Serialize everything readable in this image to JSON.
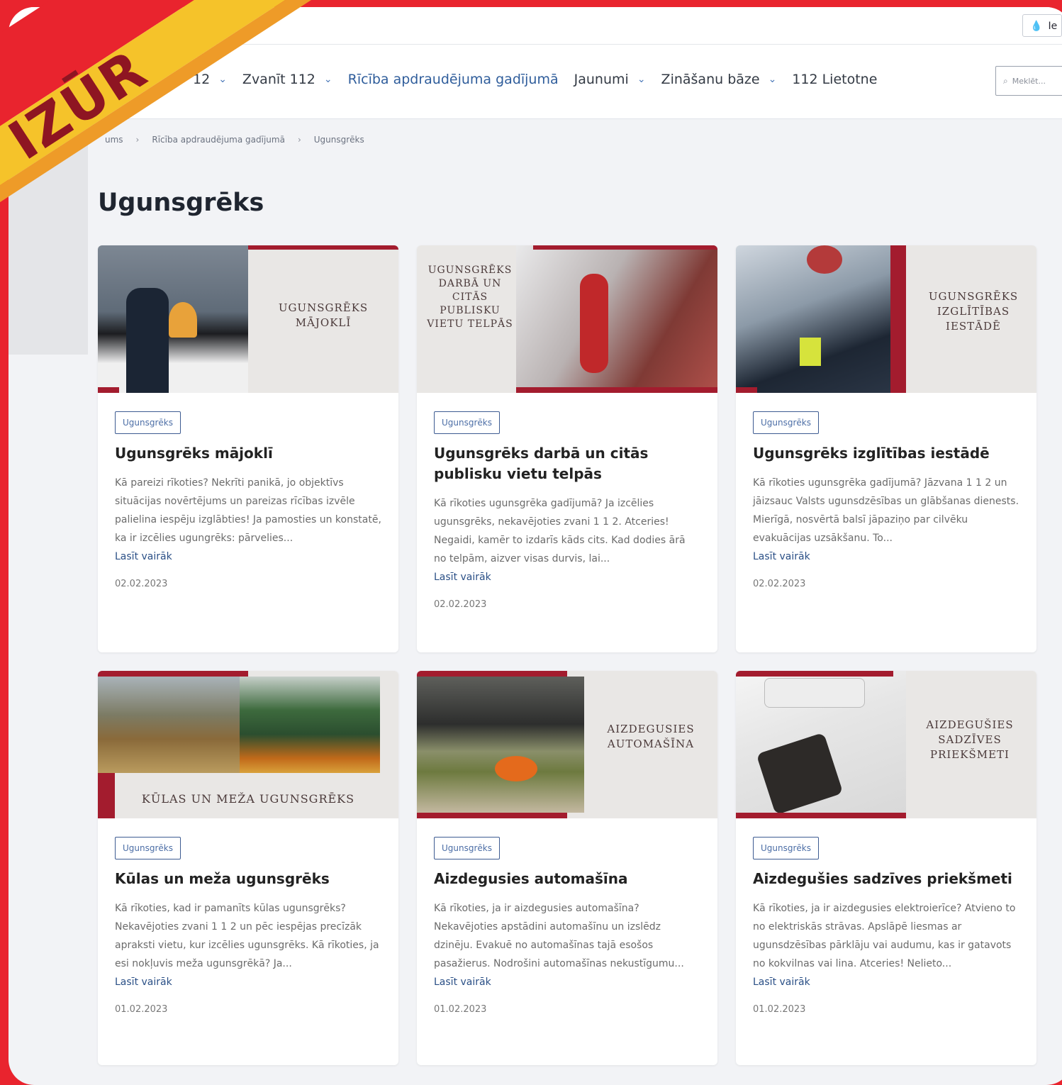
{
  "topbar": {
    "lang": "Ie"
  },
  "banner": {
    "text": "IZŪR"
  },
  "nav": {
    "items": [
      {
        "label": "12",
        "chevron": true,
        "active": false
      },
      {
        "label": "Zvanīt 112",
        "chevron": true,
        "active": false
      },
      {
        "label": "Rīcība apdraudējuma gadījumā",
        "chevron": false,
        "active": true
      },
      {
        "label": "Jaunumi",
        "chevron": true,
        "active": false
      },
      {
        "label": "Zināšanu bāze",
        "chevron": true,
        "active": false
      },
      {
        "label": "112 Lietotne",
        "chevron": false,
        "active": false
      }
    ],
    "search_placeholder": "Meklēt..."
  },
  "breadcrumb": {
    "items": [
      "ums",
      "Rīcība apdraudējuma gadījumā",
      "Ugunsgrēks"
    ]
  },
  "page": {
    "title": "Ugunsgrēks"
  },
  "more_label": "Lasīt vairāk",
  "cards": [
    {
      "tag": "Ugunsgrēks",
      "title": "Ugunsgrēks mājoklī",
      "excerpt": "Kā pareizi rīkoties? Nekrīti panikā, jo objektīvs situācijas novērtējums un pareizas rīcības izvēle palielina iespēju izglābties! Ja pamosties un konstatē, ka ir izcēlies ugungrēks: pārvelies...",
      "date": "02.02.2023",
      "thumb_text": "UGUNSGRĒKS\nMĀJOKLĪ"
    },
    {
      "tag": "Ugunsgrēks",
      "title": "Ugunsgrēks darbā un citās publisku vietu telpās",
      "excerpt": "Kā rīkoties ugunsgrēka gadījumā? Ja izcēlies ugunsgrēks, nekavējoties zvani 1 1 2. Atceries! Negaidi, kamēr to izdarīs kāds cits. Kad dodies ārā no telpām, aizver visas durvis, lai...",
      "date": "02.02.2023",
      "thumb_text": "UGUNSGRĒKS\nDARBĀ UN\nCITĀS\nPUBLISKU\nVIETU TELPĀS"
    },
    {
      "tag": "Ugunsgrēks",
      "title": "Ugunsgrēks izglītības iestādē",
      "excerpt": "Kā rīkoties ugunsgrēka gadījumā? Jāzvana 1 1 2 un jāizsauc Valsts ugunsdzēsības un glābšanas dienests. Mierīgā, nosvērtā balsī jāpaziņo par cilvēku evakuācijas uzsākšanu. To...",
      "date": "02.02.2023",
      "thumb_text": "UGUNSGRĒKS\nIZGLĪTĪBAS\nIESTĀDĒ"
    },
    {
      "tag": "Ugunsgrēks",
      "title": "Kūlas un meža ugunsgrēks",
      "excerpt": "Kā rīkoties, kad ir pamanīts kūlas ugunsgrēks? Nekavējoties zvani 1 1 2 un pēc iespējas precīzāk apraksti vietu, kur izcēlies ugunsgrēks. Kā rīkoties, ja esi nokļuvis meža ugunsgrēkā? Ja...",
      "date": "01.02.2023",
      "thumb_text": "KŪLAS UN MEŽA UGUNSGRĒKS"
    },
    {
      "tag": "Ugunsgrēks",
      "title": "Aizdegusies automašīna",
      "excerpt": "Kā rīkoties, ja ir aizdegusies automašīna? Nekavējoties apstādini automašīnu un izslēdz dzinēju. Evakuē no automašīnas tajā esošos pasažierus. Nodrošini automašīnas nekustīgumu...",
      "date": "01.02.2023",
      "thumb_text": "AIZDEGUSIES\nAUTOMAŠĪNA"
    },
    {
      "tag": "Ugunsgrēks",
      "title": "Aizdegušies sadzīves priekšmeti",
      "excerpt": "Kā rīkoties, ja ir aizdegusies elektroierīce? Atvieno to no elektriskās strāvas. Apslāpē liesmas ar ugunsdzēsības pārklāju vai audumu, kas ir gatavots no kokvilnas vai lina. Atceries! Nelieto...",
      "date": "01.02.2023",
      "thumb_text": "AIZDEGUŠIES\nSADZĪVES\nPRIEKŠMETI"
    }
  ],
  "colors": {
    "accent_red": "#a31c2e",
    "link": "#2a4f86",
    "tag_border": "#3d5b91"
  }
}
